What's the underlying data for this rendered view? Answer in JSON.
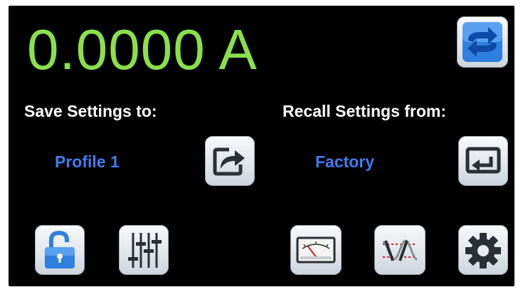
{
  "display": {
    "reading": "0.0000 A"
  },
  "save": {
    "heading": "Save Settings to:",
    "selected_profile": "Profile 1"
  },
  "recall": {
    "heading": "Recall Settings from:",
    "selected_profile": "Factory"
  },
  "buttons": [
    {
      "name": "swap-button",
      "icon": "swap-arrows-icon"
    },
    {
      "name": "save-button",
      "icon": "export-icon"
    },
    {
      "name": "recall-button",
      "icon": "return-arrow-icon"
    },
    {
      "name": "lock-button",
      "icon": "unlocked-padlock-icon"
    },
    {
      "name": "adjust-button",
      "icon": "sliders-icon"
    },
    {
      "name": "meter-button",
      "icon": "analog-meter-icon"
    },
    {
      "name": "waveform-button",
      "icon": "waveform-icon"
    },
    {
      "name": "settings-button",
      "icon": "gear-icon"
    }
  ],
  "colors": {
    "reading": "#8ae04a",
    "profile_text": "#3f7cf0",
    "heading_text": "#ffffff",
    "background": "#000000",
    "icon_blue": "#2f7fe0",
    "icon_dark": "#2b2f36"
  }
}
